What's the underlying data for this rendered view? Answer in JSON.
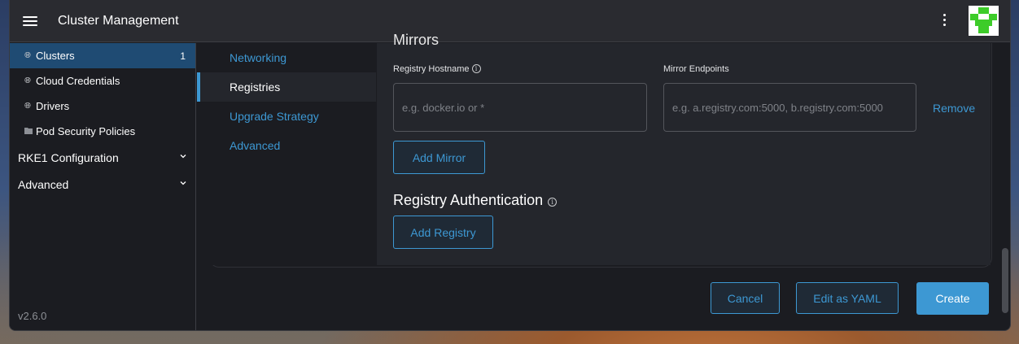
{
  "header": {
    "title": "Cluster Management"
  },
  "sidebar": {
    "items": [
      {
        "label": "Clusters",
        "count": "1",
        "icon": "globe-icon"
      },
      {
        "label": "Cloud Credentials",
        "icon": "globe-icon"
      },
      {
        "label": "Drivers",
        "icon": "globe-icon"
      },
      {
        "label": "Pod Security Policies",
        "icon": "folder-icon"
      }
    ],
    "groups": [
      {
        "label": "RKE1 Configuration"
      },
      {
        "label": "Advanced"
      }
    ],
    "version": "v2.6.0"
  },
  "tabs": [
    {
      "label": "Networking"
    },
    {
      "label": "Registries"
    },
    {
      "label": "Upgrade Strategy"
    },
    {
      "label": "Advanced"
    }
  ],
  "mirrors": {
    "partial_heading": "Mirrors",
    "hostname_label": "Registry Hostname",
    "hostname_placeholder": "e.g. docker.io or *",
    "endpoints_label": "Mirror Endpoints",
    "endpoints_placeholder": "e.g. a.registry.com:5000, b.registry.com:5000",
    "remove_label": "Remove",
    "add_mirror_label": "Add Mirror"
  },
  "auth": {
    "title": "Registry Authentication",
    "add_registry_label": "Add Registry"
  },
  "footer": {
    "cancel_label": "Cancel",
    "edit_yaml_label": "Edit as YAML",
    "create_label": "Create"
  },
  "colors": {
    "accent": "#3d98d3",
    "active_nav": "#1f4b73",
    "avatar_green": "#3dcc29"
  }
}
